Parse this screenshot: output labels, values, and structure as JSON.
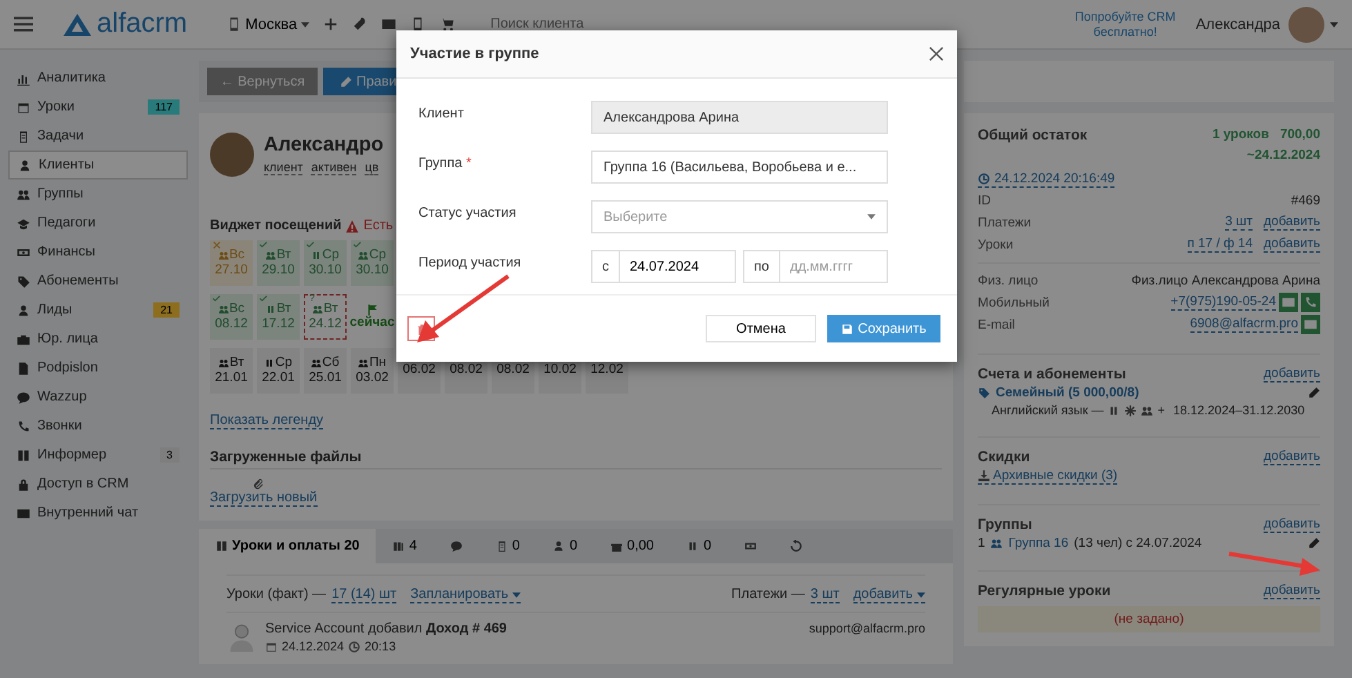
{
  "topbar": {
    "logo": "alfacrm",
    "branch": "Москва",
    "search": {
      "placeholder": "Поиск клиента"
    },
    "promo": "Попробуйте CRM бесплатно!",
    "user": "Александра"
  },
  "sidebar": {
    "items": [
      {
        "label": "Аналитика",
        "selected": false
      },
      {
        "label": "Уроки",
        "selected": false,
        "badge": {
          "text": "117",
          "color": "#2a7a7a"
        }
      },
      {
        "label": "Задачи",
        "selected": false
      },
      {
        "label": "Клиенты",
        "selected": true
      },
      {
        "label": "Группы",
        "selected": false
      },
      {
        "label": "Педагоги",
        "selected": false
      },
      {
        "label": "Финансы",
        "selected": false
      },
      {
        "label": "Абонементы",
        "selected": false
      },
      {
        "label": "Лиды",
        "selected": false,
        "badge": {
          "text": "21",
          "color": "#9a6e1e"
        }
      },
      {
        "label": "Юр. лица",
        "selected": false
      },
      {
        "label": "Podpislon",
        "selected": false
      },
      {
        "label": "Wazzup",
        "selected": false
      },
      {
        "label": "Звонки",
        "selected": false
      },
      {
        "label": "Информер",
        "selected": false,
        "badge": {
          "text": "3",
          "color": "#7e7e7e"
        }
      },
      {
        "label": "Доступ в CRM",
        "selected": false
      },
      {
        "label": "Внутренний чат",
        "selected": false
      }
    ]
  },
  "toolbar": {
    "back": "← Вернуться",
    "edit": "Прави"
  },
  "profile": {
    "name": "Александро",
    "tags": [
      "клиент",
      "активен",
      "цв"
    ]
  },
  "widget": {
    "title": "Виджет посещений",
    "alert": "Есть",
    "rows": [
      [
        {
          "kind": "missed-group",
          "day": "Вс",
          "date": "27.10"
        },
        {
          "kind": "attended-group",
          "day": "Вт",
          "date": "29.10"
        },
        {
          "kind": "attended-pause",
          "day": "Ср",
          "date": "30.10"
        },
        {
          "kind": "attended-group",
          "day": "Ср",
          "date": "30.10"
        }
      ],
      [
        {
          "kind": "attended-group",
          "day": "Вс",
          "date": "08.12"
        },
        {
          "kind": "attended-pause",
          "day": "Вт",
          "date": "17.12"
        },
        {
          "kind": "unmarked-group",
          "day": "Вт",
          "date": "24.12",
          "note": "?"
        },
        {
          "kind": "now",
          "date": "сейчас"
        }
      ],
      [
        {
          "kind": "planned-group",
          "day": "Вт",
          "date": "21.01"
        },
        {
          "kind": "planned-pause",
          "day": "Ср",
          "date": "22.01"
        },
        {
          "kind": "planned-group",
          "day": "Сб",
          "date": "25.01"
        },
        {
          "kind": "planned-group",
          "day": "Пн",
          "date": "03.02"
        },
        {
          "kind": "planned",
          "date": "06.02"
        },
        {
          "kind": "planned",
          "date": "08.02"
        },
        {
          "kind": "planned",
          "date": "08.02"
        },
        {
          "kind": "planned",
          "date": "10.02"
        },
        {
          "kind": "planned",
          "date": "12.02"
        }
      ]
    ],
    "legend_link": "Показать легенду"
  },
  "files": {
    "title": "Загруженные файлы",
    "upload": "Загрузить новый"
  },
  "tabs": [
    {
      "label": "Уроки и оплаты 20",
      "selected": true
    },
    {
      "label": "4",
      "selected": false
    },
    {
      "selected": false
    },
    {
      "label": "0",
      "selected": false
    },
    {
      "label": "0",
      "selected": false
    },
    {
      "label": "0,00",
      "selected": false
    },
    {
      "label": "0",
      "selected": false
    },
    {
      "selected": false
    },
    {
      "selected": false
    }
  ],
  "lessons": {
    "fact_label": "Уроки (факт) —",
    "fact_count": "17 (14) шт",
    "plan": "Запланировать",
    "payments_label": "Платежи —",
    "payments_count": "3 шт",
    "add": "добавить"
  },
  "feed": [
    {
      "text": "Service Account добавил **Доход # 469**",
      "date": "24.12.2024",
      "time": "20:13",
      "email": "support@alfacrm.pro"
    }
  ],
  "balance": {
    "title": "Общий остаток",
    "lessons": "1 уроков",
    "amount": "700,00",
    "until": "~24.12.2024",
    "updated": "24.12.2024 20:16:49"
  },
  "info_rows": [
    {
      "kind": "text",
      "label": "ID",
      "value": "#469"
    },
    {
      "kind": "link",
      "label": "Платежи",
      "value": "3 шт",
      "action": "добавить"
    },
    {
      "kind": "link",
      "label": "Уроки",
      "value": "п 17 / ф 14",
      "action": "добавить"
    }
  ],
  "contact_rows": [
    {
      "kind": "text",
      "label": "Физ. лицо",
      "value": "Физ.лицо Александрова Арина"
    },
    {
      "kind": "phone",
      "label": "Мобильный",
      "value": "+7(975)190-05-24"
    },
    {
      "kind": "email",
      "label": "E-mail",
      "value": "6908@alfacrm.pro"
    }
  ],
  "subscriptions": {
    "title": "Счета и абонементы",
    "action": "добавить",
    "name": "Семейный (5 000,00/8)",
    "subject": "Английский язык —",
    "plus": "+",
    "period": "18.12.2024–31.12.2030"
  },
  "discounts": {
    "title": "Скидки",
    "action": "добавить",
    "archive": "Архивные скидки (3)"
  },
  "groups": {
    "title": "Группы",
    "action": "добавить",
    "items": [
      {
        "number": "1",
        "name": "Группа 16",
        "details": "(13 чел) с 24.07.2024"
      }
    ]
  },
  "regular": {
    "title": "Регулярные уроки",
    "action": "добавить",
    "empty": "(не задано)"
  },
  "modal": {
    "title": "Участие в группе",
    "client_label": "Клиент",
    "client": "Александрова Арина",
    "group_label": "Группа",
    "required": "*",
    "group": "Группа 16 (Васильева, Воробьева и е...",
    "status_label": "Статус участия",
    "status": {
      "placeholder": "Выберите"
    },
    "period_label": "Период участия",
    "from_label": "с",
    "from": "24.07.2024",
    "to_label": "по",
    "to": {
      "placeholder": "дд.мм.гггг"
    },
    "cancel": "Отмена",
    "save": "Сохранить"
  }
}
